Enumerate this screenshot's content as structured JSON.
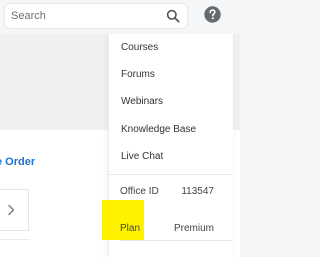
{
  "search": {
    "placeholder": "Search"
  },
  "icons": {
    "search": "search-icon",
    "help": "question-circle-icon",
    "chevron": "chevron-right-icon"
  },
  "page": {
    "order_link": "e Order"
  },
  "menu": {
    "items": [
      {
        "label": "Courses"
      },
      {
        "label": "Forums"
      },
      {
        "label": "Webinars"
      },
      {
        "label": "Knowledge Base"
      },
      {
        "label": "Live Chat"
      }
    ],
    "office_id": {
      "label": "Office ID",
      "value": "113547"
    },
    "plan": {
      "label": "Plan",
      "value": "Premium"
    }
  },
  "colors": {
    "link": "#1f73d1",
    "highlight": "#fff200",
    "help_icon": "#666a6e"
  }
}
